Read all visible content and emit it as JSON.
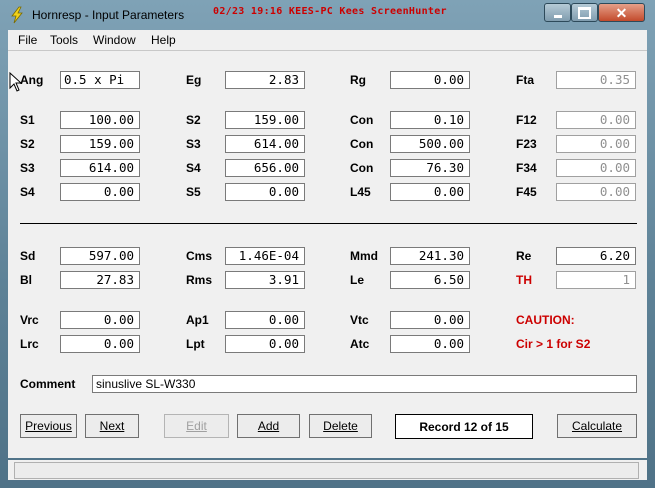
{
  "window": {
    "title": "Hornresp - Input Parameters",
    "overlay_text": "02/23 19:16 KEES-PC Kees ScreenHunter",
    "app_icon": "lightning-icon",
    "buttons": {
      "minimize": "minimize-icon",
      "maximize": "maximize-icon",
      "close": "close-icon"
    }
  },
  "menu": [
    "File",
    "Tools",
    "Window",
    "Help"
  ],
  "params": {
    "ang": {
      "label": "Ang",
      "value": "0.5 x Pi"
    },
    "eg": {
      "label": "Eg",
      "value": "2.83"
    },
    "rg": {
      "label": "Rg",
      "value": "0.00"
    },
    "fta": {
      "label": "Fta",
      "value": "0.35"
    },
    "s1": {
      "label": "S1",
      "value": "100.00"
    },
    "s2a": {
      "label": "S2",
      "value": "159.00"
    },
    "con1": {
      "label": "Con",
      "value": "0.10"
    },
    "f12": {
      "label": "F12",
      "value": "0.00"
    },
    "s2": {
      "label": "S2",
      "value": "159.00"
    },
    "s3a": {
      "label": "S3",
      "value": "614.00"
    },
    "con2": {
      "label": "Con",
      "value": "500.00"
    },
    "f23": {
      "label": "F23",
      "value": "0.00"
    },
    "s3": {
      "label": "S3",
      "value": "614.00"
    },
    "s4a": {
      "label": "S4",
      "value": "656.00"
    },
    "con3": {
      "label": "Con",
      "value": "76.30"
    },
    "f34": {
      "label": "F34",
      "value": "0.00"
    },
    "s4": {
      "label": "S4",
      "value": "0.00"
    },
    "s5": {
      "label": "S5",
      "value": "0.00"
    },
    "l45": {
      "label": "L45",
      "value": "0.00"
    },
    "f45": {
      "label": "F45",
      "value": "0.00"
    },
    "sd": {
      "label": "Sd",
      "value": "597.00"
    },
    "cms": {
      "label": "Cms",
      "value": "1.46E-04"
    },
    "mmd": {
      "label": "Mmd",
      "value": "241.30"
    },
    "re": {
      "label": "Re",
      "value": "6.20"
    },
    "bl": {
      "label": "Bl",
      "value": "27.83"
    },
    "rms": {
      "label": "Rms",
      "value": "3.91"
    },
    "le": {
      "label": "Le",
      "value": "6.50"
    },
    "th": {
      "label": "TH",
      "value": "1"
    },
    "vrc": {
      "label": "Vrc",
      "value": "0.00"
    },
    "ap1": {
      "label": "Ap1",
      "value": "0.00"
    },
    "vtc": {
      "label": "Vtc",
      "value": "0.00"
    },
    "lrc": {
      "label": "Lrc",
      "value": "0.00"
    },
    "lpt": {
      "label": "Lpt",
      "value": "0.00"
    },
    "atc": {
      "label": "Atc",
      "value": "0.00"
    }
  },
  "caution": {
    "title": "CAUTION:",
    "message": "Cir > 1 for S2"
  },
  "comment": {
    "label": "Comment",
    "value": "sinuslive SL-W330"
  },
  "buttons": {
    "previous": "Previous",
    "next": "Next",
    "edit": "Edit",
    "add": "Add",
    "delete": "Delete",
    "calculate": "Calculate"
  },
  "record": "Record 12 of 15",
  "colors": {
    "caution": "#cc0000",
    "title_overlay": "#cc0000"
  }
}
